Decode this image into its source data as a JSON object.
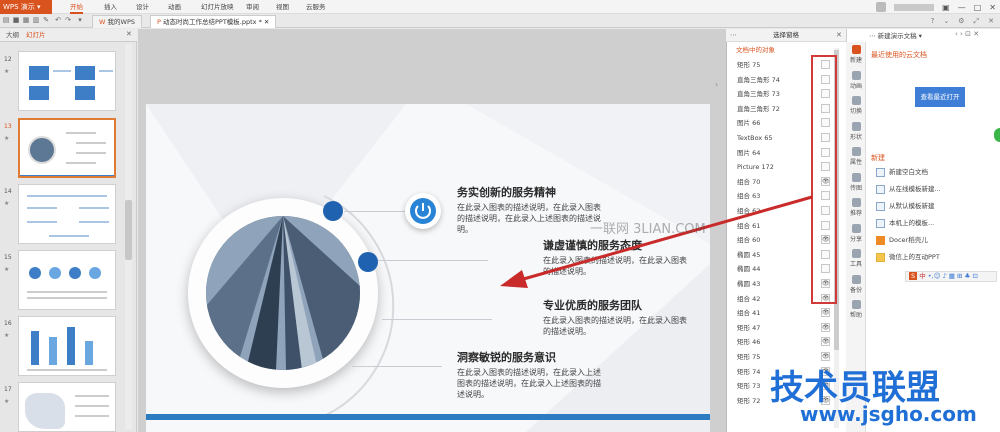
{
  "app": {
    "name": "WPS 演示"
  },
  "menu": {
    "items": [
      "开始",
      "插入",
      "设计",
      "动画",
      "幻灯片放映",
      "审阅",
      "视图",
      "云服务"
    ]
  },
  "tabs": [
    {
      "label": "我的WPS"
    },
    {
      "label": "动态时尚工作总结PPT模板.pptx *"
    }
  ],
  "left_pane": {
    "tabs": [
      "大纲",
      "幻灯片"
    ],
    "slide_numbers": [
      "12",
      "13",
      "14",
      "15",
      "16",
      "17"
    ]
  },
  "slide": {
    "items": [
      {
        "title": "务实创新的服务精神",
        "desc": "在此录入图表的描述说明，在此录入图表的描述说明，在此录入上述图表的描述说明。"
      },
      {
        "title": "谦虚谨慎的服务态度",
        "desc": "在此录入图表的描述说明，在此录入图表的描述说明。"
      },
      {
        "title": "专业优质的服务团队",
        "desc": "在此录入图表的描述说明，在此录入图表的描述说明。"
      },
      {
        "title": "洞察敏锐的服务意识",
        "desc": "在此录入图表的描述说明，在此录入上述图表的描述说明，在此录入上述图表的描述说明。"
      }
    ]
  },
  "selection_pane": {
    "title": "选择窗格",
    "subtitle": "文档中的对象",
    "objects": [
      "矩形 75",
      "直角三角形 74",
      "直角三角形 73",
      "直角三角形 72",
      "图片 66",
      "TextBox 65",
      "图片 64",
      "Picture 172",
      "组合 70",
      "组合 63",
      "组合 62",
      "组合 61",
      "组合 60",
      "椭圆 45",
      "椭圆 44",
      "椭圆 43",
      "组合 42",
      "组合 41",
      "矩形 47",
      "矩形 46",
      "矩形 75",
      "矩形 74",
      "矩形 73",
      "矩形 72"
    ],
    "visible_flags": [
      false,
      false,
      false,
      false,
      false,
      false,
      false,
      false,
      true,
      false,
      false,
      false,
      true,
      false,
      false,
      true,
      true,
      true,
      true,
      true,
      true,
      true,
      true,
      true
    ]
  },
  "right_panel": {
    "header": "新建演示文稿",
    "recent_title": "最近使用的云文档",
    "open_button": "查看最近打开",
    "new_title": "新建",
    "new_items": [
      "新建空白文档",
      "从在线模板新建...",
      "从默认模板新建",
      "本机上的模板...",
      "Docer稻壳儿",
      "微信上的互动PPT"
    ],
    "side_tabs": [
      "新建",
      "动画",
      "切换",
      "形状",
      "属性",
      "传图",
      "推荐",
      "分享",
      "工具",
      "备份",
      "帮助"
    ]
  },
  "ime": {
    "label": "中"
  },
  "watermarks": {
    "center": "一联网 3LIAN.COM",
    "brand": "技术员联盟",
    "url": "www.jsgho.com"
  },
  "colors": {
    "accent": "#d9531e",
    "slide_blue": "#2d7bc0",
    "annotation_red": "#d23a3a"
  }
}
